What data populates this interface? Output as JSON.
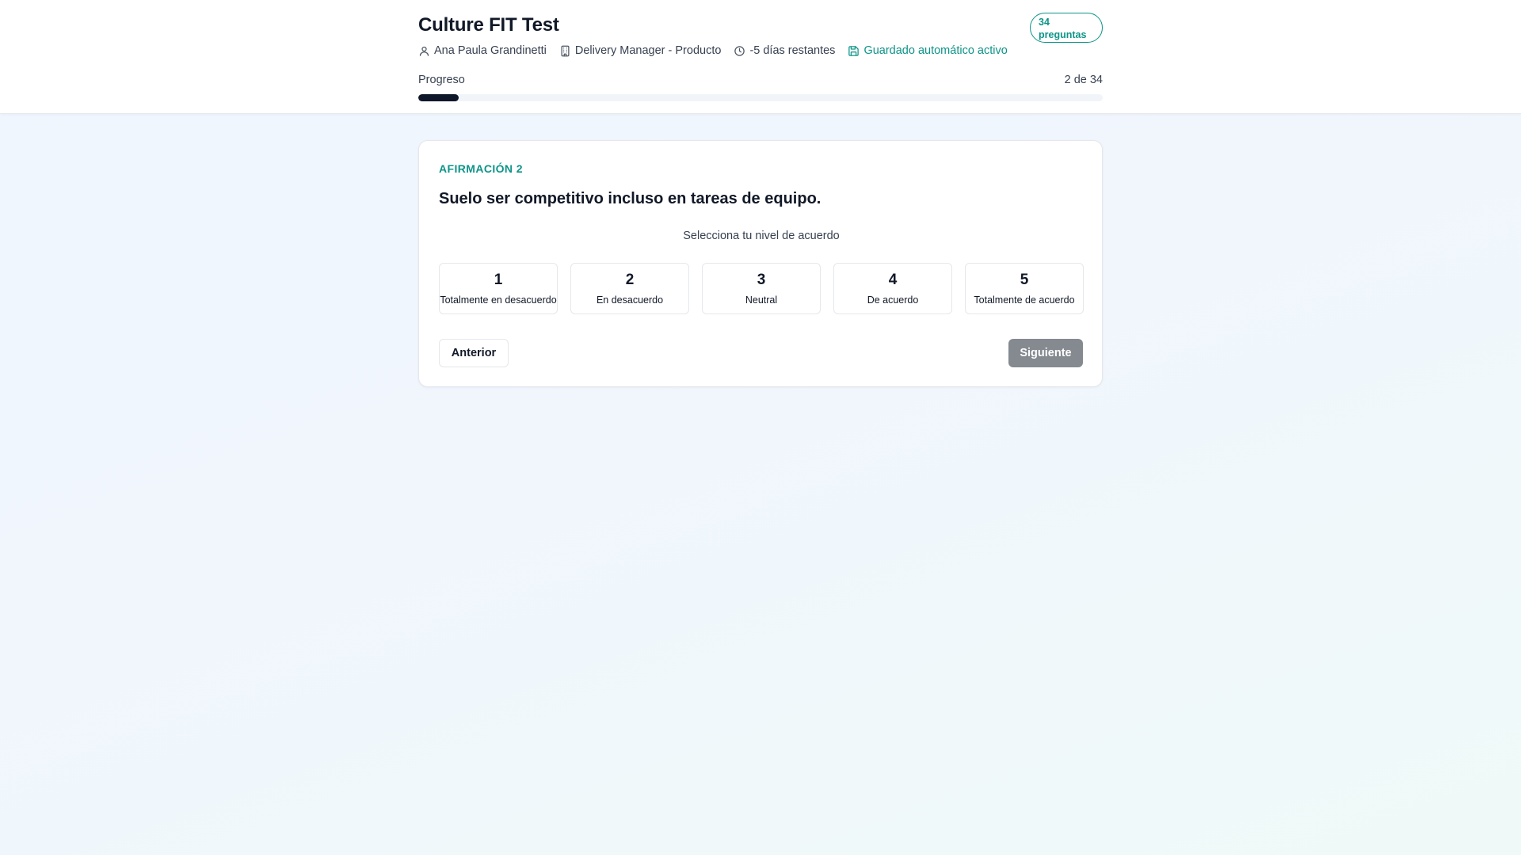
{
  "header": {
    "title": "Culture FIT Test",
    "badge": "34 preguntas",
    "meta": {
      "user": "Ana Paula Grandinetti",
      "role": "Delivery Manager - Producto",
      "time_left": "-5 días restantes",
      "autosave": "Guardado automático activo"
    },
    "progress": {
      "label": "Progreso",
      "count_text": "2 de 34",
      "current": 2,
      "total": 34
    }
  },
  "question": {
    "label": "AFIRMACIÓN 2",
    "text": "Suelo ser competitivo incluso en tareas de equipo.",
    "prompt": "Selecciona tu nivel de acuerdo",
    "options": [
      {
        "value": "1",
        "label": "Totalmente en desacuerdo"
      },
      {
        "value": "2",
        "label": "En desacuerdo"
      },
      {
        "value": "3",
        "label": "Neutral"
      },
      {
        "value": "4",
        "label": "De acuerdo"
      },
      {
        "value": "5",
        "label": "Totalmente de acuerdo"
      }
    ]
  },
  "nav": {
    "prev_label": "Anterior",
    "next_label": "Siguiente",
    "next_enabled": false
  },
  "colors": {
    "accent": "#0d9488",
    "progress_fill": "#0f172a",
    "disabled_button": "#858a91"
  },
  "icons": {
    "user": "user-icon",
    "role": "building-icon",
    "time": "clock-icon",
    "autosave": "save-icon"
  }
}
